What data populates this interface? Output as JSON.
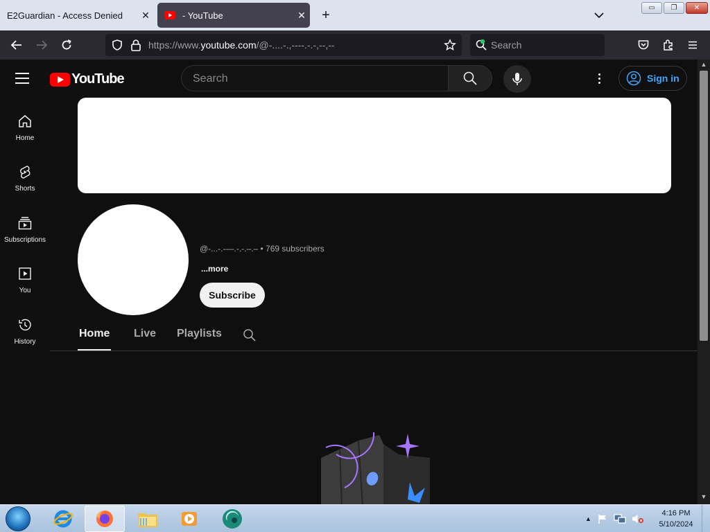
{
  "browser": {
    "tabs": [
      {
        "title": "E2Guardian - Access Denied",
        "active": false
      },
      {
        "title": "- YouTube",
        "active": true
      }
    ],
    "url": {
      "scheme": "https://www.",
      "host": "youtube.com",
      "path": "/@-....-.,----.-.-,--,--"
    },
    "search_placeholder": "Search",
    "window_buttons": {
      "minimize": "▭",
      "maximize": "❐",
      "close": "✕"
    }
  },
  "youtube": {
    "logo_text": "YouTube",
    "search_placeholder": "Search",
    "sign_in_label": "Sign in",
    "guide": [
      {
        "label": "Home",
        "icon": "home-icon"
      },
      {
        "label": "Shorts",
        "icon": "shorts-icon"
      },
      {
        "label": "Subscriptions",
        "icon": "subscriptions-icon"
      },
      {
        "label": "You",
        "icon": "you-icon"
      },
      {
        "label": "History",
        "icon": "history-icon"
      }
    ],
    "channel": {
      "meta": "@-...-.-—.-.-.–.– • 769 subscribers",
      "more_label": "...more",
      "subscribe_label": "Subscribe"
    },
    "channel_tabs": [
      "Home",
      "Live",
      "Playlists"
    ],
    "active_tab": "Home"
  },
  "taskbar": {
    "apps": [
      "internet-explorer",
      "firefox",
      "file-explorer",
      "media-player",
      "app-icon"
    ],
    "time": "4:16 PM",
    "date": "5/10/2024"
  },
  "colors": {
    "yt_background": "#0f0f0f",
    "yt_red": "#ff0000",
    "link_blue": "#3ea6ff",
    "firefox_toolbar": "#2b2a33"
  }
}
